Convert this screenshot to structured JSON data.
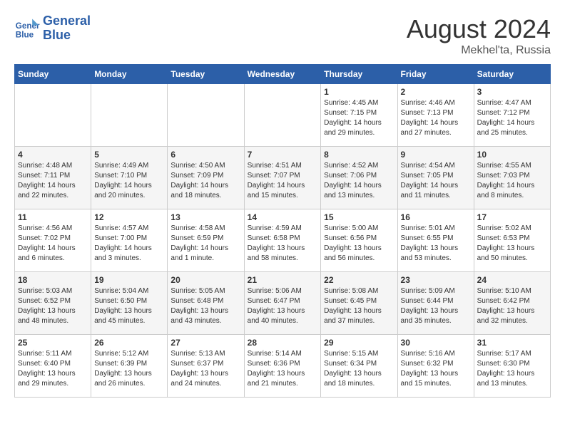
{
  "header": {
    "logo_line1": "General",
    "logo_line2": "Blue",
    "month_year": "August 2024",
    "location": "Mekhel'ta, Russia"
  },
  "days_of_week": [
    "Sunday",
    "Monday",
    "Tuesday",
    "Wednesday",
    "Thursday",
    "Friday",
    "Saturday"
  ],
  "weeks": [
    [
      {
        "day": "",
        "info": ""
      },
      {
        "day": "",
        "info": ""
      },
      {
        "day": "",
        "info": ""
      },
      {
        "day": "",
        "info": ""
      },
      {
        "day": "1",
        "info": "Sunrise: 4:45 AM\nSunset: 7:15 PM\nDaylight: 14 hours\nand 29 minutes."
      },
      {
        "day": "2",
        "info": "Sunrise: 4:46 AM\nSunset: 7:13 PM\nDaylight: 14 hours\nand 27 minutes."
      },
      {
        "day": "3",
        "info": "Sunrise: 4:47 AM\nSunset: 7:12 PM\nDaylight: 14 hours\nand 25 minutes."
      }
    ],
    [
      {
        "day": "4",
        "info": "Sunrise: 4:48 AM\nSunset: 7:11 PM\nDaylight: 14 hours\nand 22 minutes."
      },
      {
        "day": "5",
        "info": "Sunrise: 4:49 AM\nSunset: 7:10 PM\nDaylight: 14 hours\nand 20 minutes."
      },
      {
        "day": "6",
        "info": "Sunrise: 4:50 AM\nSunset: 7:09 PM\nDaylight: 14 hours\nand 18 minutes."
      },
      {
        "day": "7",
        "info": "Sunrise: 4:51 AM\nSunset: 7:07 PM\nDaylight: 14 hours\nand 15 minutes."
      },
      {
        "day": "8",
        "info": "Sunrise: 4:52 AM\nSunset: 7:06 PM\nDaylight: 14 hours\nand 13 minutes."
      },
      {
        "day": "9",
        "info": "Sunrise: 4:54 AM\nSunset: 7:05 PM\nDaylight: 14 hours\nand 11 minutes."
      },
      {
        "day": "10",
        "info": "Sunrise: 4:55 AM\nSunset: 7:03 PM\nDaylight: 14 hours\nand 8 minutes."
      }
    ],
    [
      {
        "day": "11",
        "info": "Sunrise: 4:56 AM\nSunset: 7:02 PM\nDaylight: 14 hours\nand 6 minutes."
      },
      {
        "day": "12",
        "info": "Sunrise: 4:57 AM\nSunset: 7:00 PM\nDaylight: 14 hours\nand 3 minutes."
      },
      {
        "day": "13",
        "info": "Sunrise: 4:58 AM\nSunset: 6:59 PM\nDaylight: 14 hours\nand 1 minute."
      },
      {
        "day": "14",
        "info": "Sunrise: 4:59 AM\nSunset: 6:58 PM\nDaylight: 13 hours\nand 58 minutes."
      },
      {
        "day": "15",
        "info": "Sunrise: 5:00 AM\nSunset: 6:56 PM\nDaylight: 13 hours\nand 56 minutes."
      },
      {
        "day": "16",
        "info": "Sunrise: 5:01 AM\nSunset: 6:55 PM\nDaylight: 13 hours\nand 53 minutes."
      },
      {
        "day": "17",
        "info": "Sunrise: 5:02 AM\nSunset: 6:53 PM\nDaylight: 13 hours\nand 50 minutes."
      }
    ],
    [
      {
        "day": "18",
        "info": "Sunrise: 5:03 AM\nSunset: 6:52 PM\nDaylight: 13 hours\nand 48 minutes."
      },
      {
        "day": "19",
        "info": "Sunrise: 5:04 AM\nSunset: 6:50 PM\nDaylight: 13 hours\nand 45 minutes."
      },
      {
        "day": "20",
        "info": "Sunrise: 5:05 AM\nSunset: 6:48 PM\nDaylight: 13 hours\nand 43 minutes."
      },
      {
        "day": "21",
        "info": "Sunrise: 5:06 AM\nSunset: 6:47 PM\nDaylight: 13 hours\nand 40 minutes."
      },
      {
        "day": "22",
        "info": "Sunrise: 5:08 AM\nSunset: 6:45 PM\nDaylight: 13 hours\nand 37 minutes."
      },
      {
        "day": "23",
        "info": "Sunrise: 5:09 AM\nSunset: 6:44 PM\nDaylight: 13 hours\nand 35 minutes."
      },
      {
        "day": "24",
        "info": "Sunrise: 5:10 AM\nSunset: 6:42 PM\nDaylight: 13 hours\nand 32 minutes."
      }
    ],
    [
      {
        "day": "25",
        "info": "Sunrise: 5:11 AM\nSunset: 6:40 PM\nDaylight: 13 hours\nand 29 minutes."
      },
      {
        "day": "26",
        "info": "Sunrise: 5:12 AM\nSunset: 6:39 PM\nDaylight: 13 hours\nand 26 minutes."
      },
      {
        "day": "27",
        "info": "Sunrise: 5:13 AM\nSunset: 6:37 PM\nDaylight: 13 hours\nand 24 minutes."
      },
      {
        "day": "28",
        "info": "Sunrise: 5:14 AM\nSunset: 6:36 PM\nDaylight: 13 hours\nand 21 minutes."
      },
      {
        "day": "29",
        "info": "Sunrise: 5:15 AM\nSunset: 6:34 PM\nDaylight: 13 hours\nand 18 minutes."
      },
      {
        "day": "30",
        "info": "Sunrise: 5:16 AM\nSunset: 6:32 PM\nDaylight: 13 hours\nand 15 minutes."
      },
      {
        "day": "31",
        "info": "Sunrise: 5:17 AM\nSunset: 6:30 PM\nDaylight: 13 hours\nand 13 minutes."
      }
    ]
  ]
}
